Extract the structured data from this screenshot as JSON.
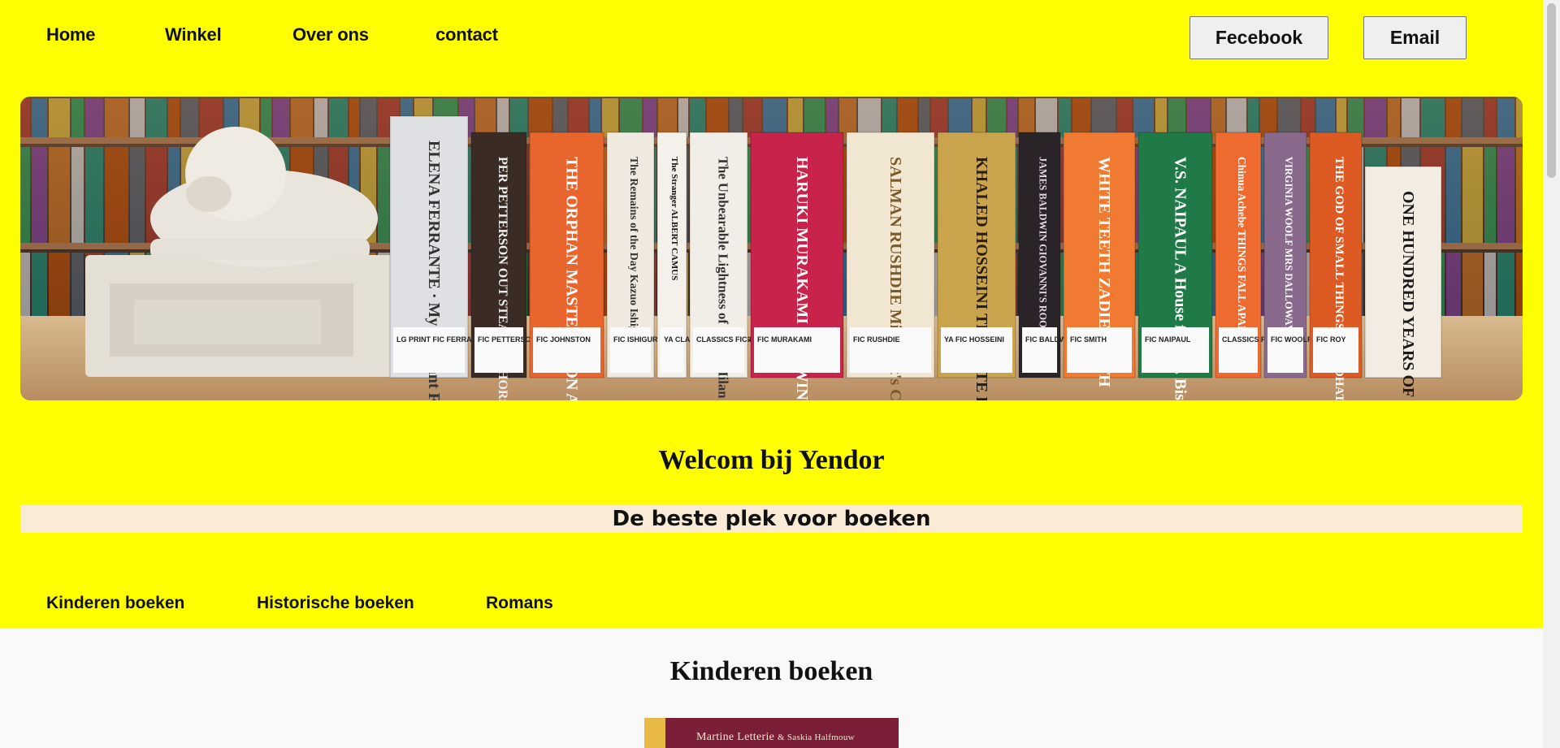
{
  "nav": {
    "home": "Home",
    "shop": "Winkel",
    "about": "Over ons",
    "contact": "contact"
  },
  "social": {
    "facebook": "Fecebook",
    "email": "Email"
  },
  "hero": {
    "books": [
      {
        "title": "ELENA FERRANTE · My Brilliant Friend",
        "label": "LG PRINT FIC FERRANTE",
        "color": "#dfe0e4",
        "text": "#333"
      },
      {
        "title": "PER PETTERSON  OUT STEALING HORSES",
        "label": "FIC PETTERSON",
        "color": "#3a2c24",
        "text": "#eee"
      },
      {
        "title": "THE ORPHAN MASTER'S SON  ADAM JOHNSON",
        "label": "FIC JOHNSTON",
        "color": "#e8652d",
        "text": "#fff"
      },
      {
        "title": "The Remains of the Day  Kazuo Ishiguro",
        "label": "FIC ISHIGURO",
        "color": "#efe9df",
        "text": "#333"
      },
      {
        "title": "The Stranger  ALBERT CAMUS",
        "label": "YA CLASSIC FIC CAMUS",
        "color": "#f4f1ea",
        "text": "#111"
      },
      {
        "title": "The Unbearable Lightness of Being  Milan Kundera",
        "label": "CLASSICS FIC KUNDERA",
        "color": "#f1eee7",
        "text": "#333"
      },
      {
        "title": "HARUKI MURAKAMI  THE WIND-UP BIRD CHRONICLE",
        "label": "FIC MURAKAMI",
        "color": "#c8234a",
        "text": "#fff"
      },
      {
        "title": "SALMAN RUSHDIE  Midnight's Children",
        "label": "FIC RUSHDIE",
        "color": "#f0e6d2",
        "text": "#7a5a2a"
      },
      {
        "title": "KHALED HOSSEINI  THE KITE RUNNER",
        "label": "YA FIC HOSSEINI",
        "color": "#c9a44c",
        "text": "#2a1e10"
      },
      {
        "title": "JAMES BALDWIN  GIOVANNI'S ROOM",
        "label": "FIC BALDWIN",
        "color": "#2a2428",
        "text": "#e7d8e8"
      },
      {
        "title": "WHITE TEETH  ZADIE SMITH",
        "label": "FIC SMITH",
        "color": "#f07a32",
        "text": "#fff"
      },
      {
        "title": "V.S. NAIPAUL  A House for Mr. Biswas",
        "label": "FIC NAIPAUL",
        "color": "#1f7a47",
        "text": "#fff"
      },
      {
        "title": "Chinua Achebe  THINGS FALL APART",
        "label": "CLASSICS FIC ACHEBE",
        "color": "#ef6a2e",
        "text": "#fff"
      },
      {
        "title": "VIRGINIA WOOLF  MRS DALLOWAY",
        "label": "FIC WOOLF",
        "color": "#8a6a8c",
        "text": "#fff"
      },
      {
        "title": "THE GOD OF SMALL THINGS  ARUNDHATI ROY",
        "label": "FIC ROY",
        "color": "#dd5a22",
        "text": "#fff"
      },
      {
        "title": "ONE HUNDRED YEARS OF SOLITUDE",
        "label": "",
        "color": "#f2ece2",
        "text": "#1a1a1a"
      }
    ]
  },
  "welcome": "Welcom bij Yendor",
  "tagline": "De beste plek voor boeken",
  "categories": {
    "kids": "Kinderen boeken",
    "history": "Historische boeken",
    "novels": "Romans"
  },
  "section": {
    "title": "Kinderen boeken",
    "book_author": "Martine Letterie",
    "book_coauthor": "& Saskia Halfmouw"
  }
}
